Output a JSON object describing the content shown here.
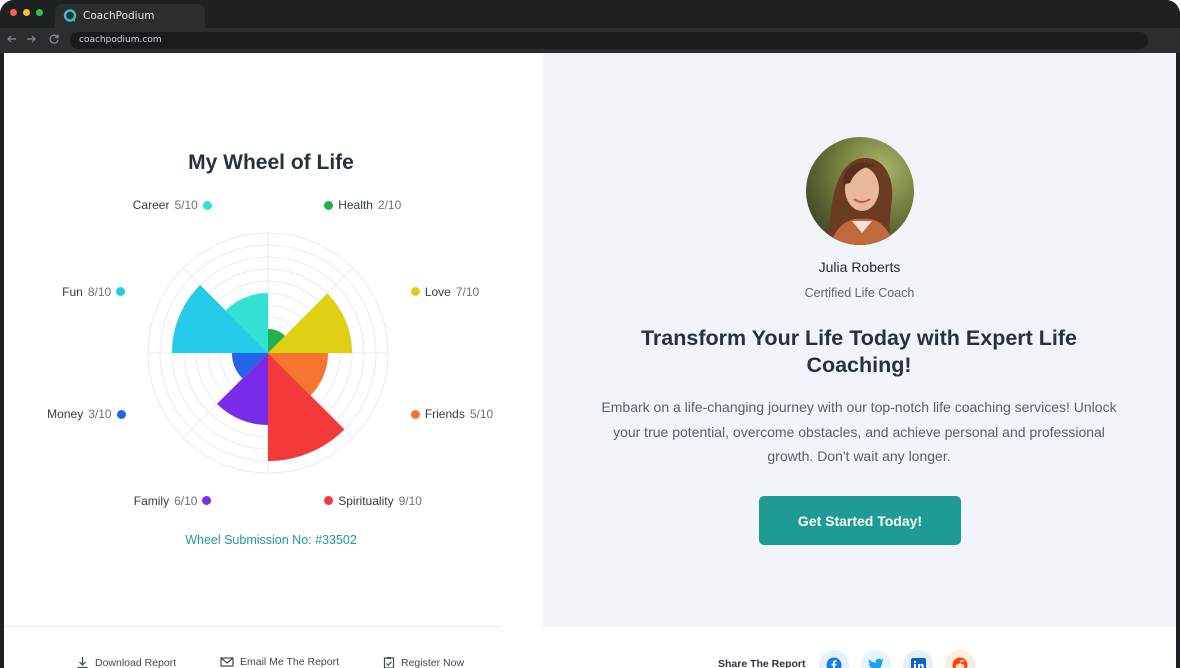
{
  "browser": {
    "tab_title": "CoachPodium",
    "url": "coachpodium.com",
    "back_icon": "arrow-left-icon",
    "forward_icon": "arrow-right-icon",
    "reload_icon": "reload-icon"
  },
  "wheel": {
    "title": "My Wheel of Life",
    "max_score": 10,
    "segments": [
      {
        "label": "Health",
        "score": 2,
        "score_text": "2/10",
        "color": "#22b04b"
      },
      {
        "label": "Love",
        "score": 7,
        "score_text": "7/10",
        "color": "#e0d014"
      },
      {
        "label": "Friends",
        "score": 5,
        "score_text": "5/10",
        "color": "#f7762f"
      },
      {
        "label": "Spirituality",
        "score": 9,
        "score_text": "9/10",
        "color": "#f23a3a"
      },
      {
        "label": "Family",
        "score": 6,
        "score_text": "6/10",
        "color": "#7a2bea"
      },
      {
        "label": "Money",
        "score": 3,
        "score_text": "3/10",
        "color": "#2563eb"
      },
      {
        "label": "Fun",
        "score": 8,
        "score_text": "8/10",
        "color": "#25cbe8"
      },
      {
        "label": "Career",
        "score": 5,
        "score_text": "5/10",
        "color": "#33e0d4"
      }
    ],
    "submission": "Wheel Submission No: #33502"
  },
  "coach": {
    "name": "Julia Roberts",
    "role": "Certified Life Coach"
  },
  "promo": {
    "headline": "Transform Your Life Today with Expert Life Coaching!",
    "description": "Embark on a life-changing journey with our top-notch life coaching services! Unlock your true potential, overcome obstacles, and achieve personal and professional growth. Don't wait any longer.",
    "cta": "Get Started Today!",
    "accent": "#1e9b94"
  },
  "footer": {
    "download": "Download Report",
    "email": "Email Me The Report",
    "register": "Register Now",
    "share_label": "Share The Report",
    "social": [
      {
        "name": "facebook-icon",
        "color": "#1877f2",
        "bg": "#e7f0fd"
      },
      {
        "name": "twitter-icon",
        "color": "#1da1f2",
        "bg": "#e6f4fd"
      },
      {
        "name": "linkedin-icon",
        "color": "#0a66c2",
        "bg": "#e6eef8"
      },
      {
        "name": "reddit-icon",
        "color": "#ff4500",
        "bg": "#fdece4"
      }
    ]
  }
}
